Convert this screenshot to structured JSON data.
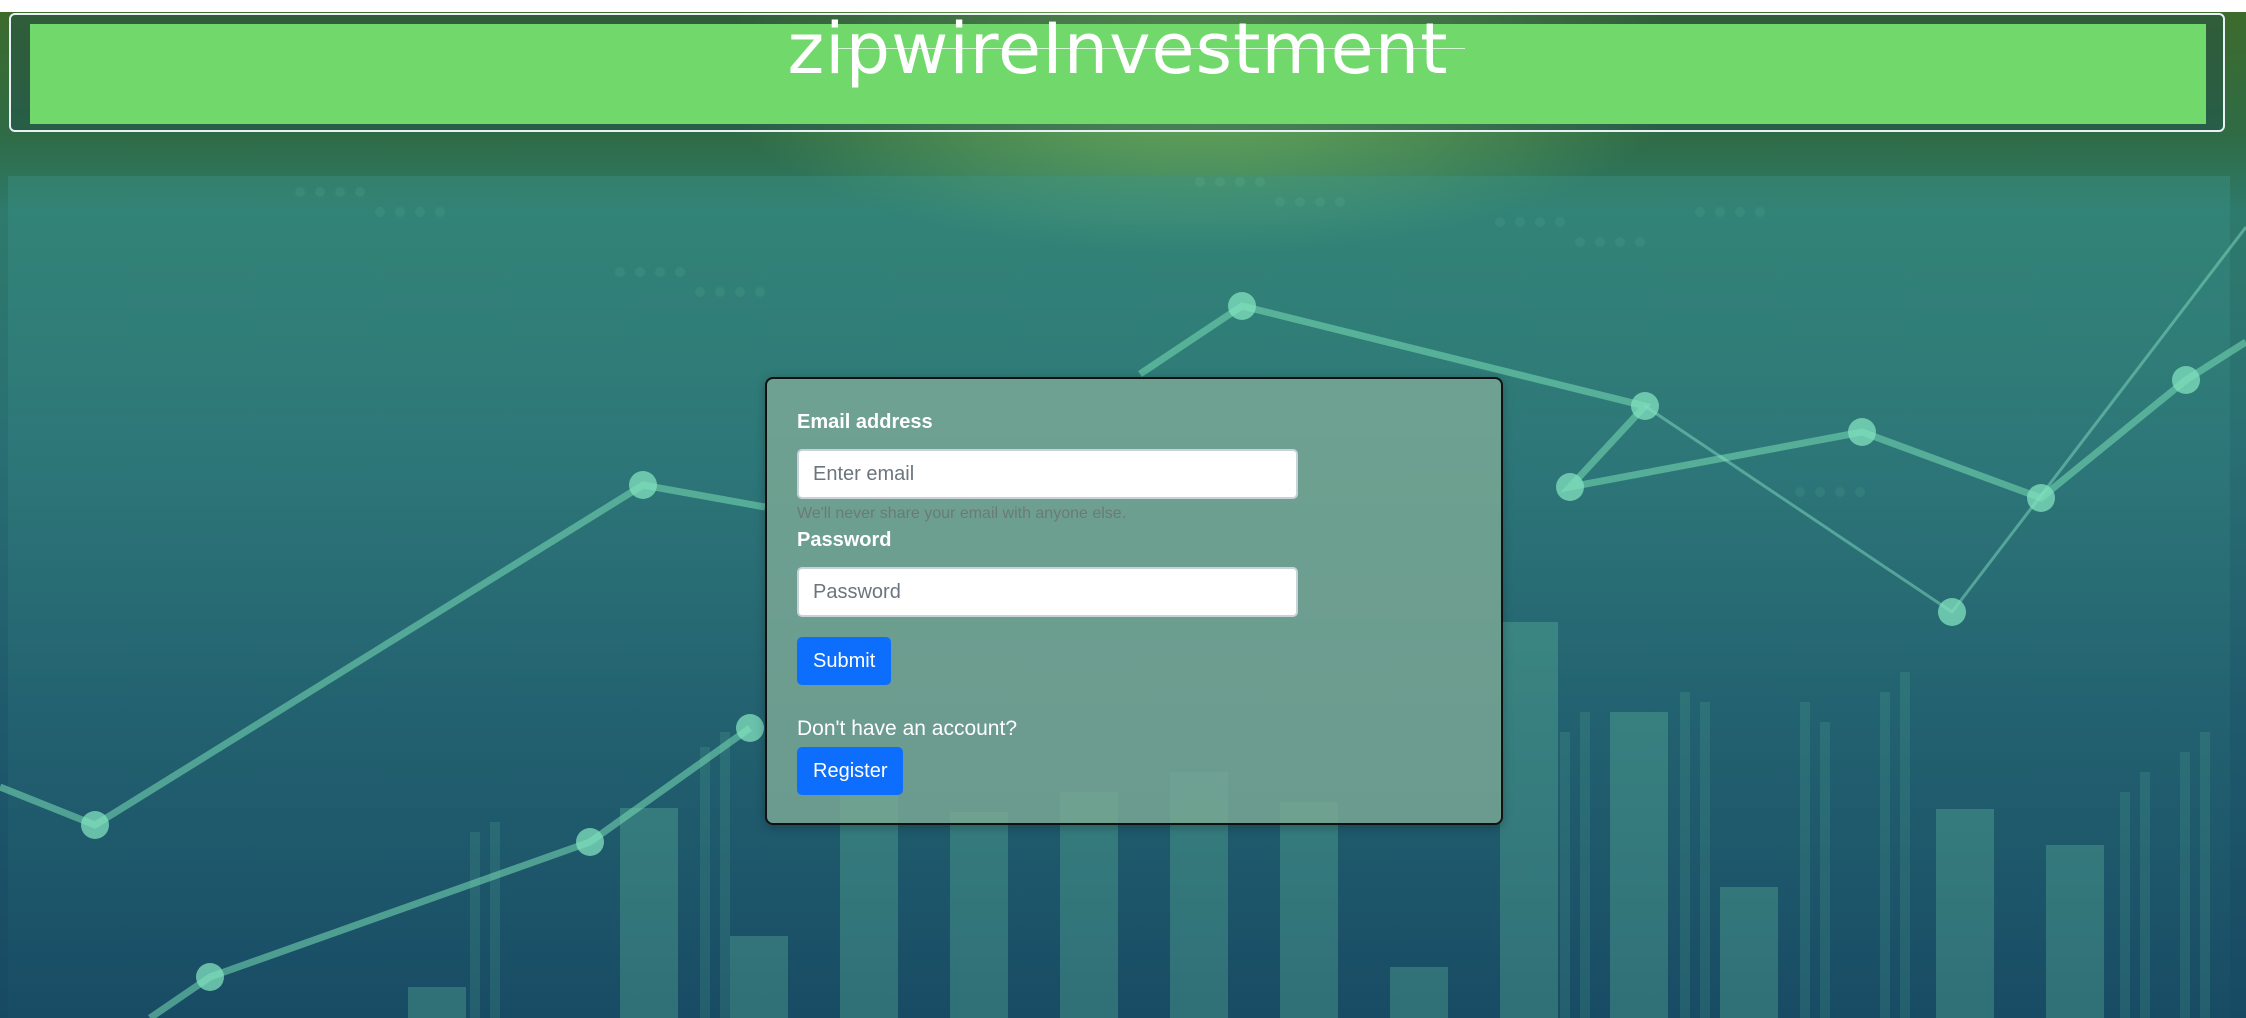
{
  "header": {
    "title": "zipwireInvestment"
  },
  "login_form": {
    "email_label": "Email address",
    "email_placeholder": "Enter email",
    "email_value": "",
    "email_help": "We'll never share your email with anyone else.",
    "password_label": "Password",
    "password_placeholder": "Password",
    "password_value": "",
    "submit_label": "Submit",
    "no_account_text": "Don't have an account?",
    "register_label": "Register"
  },
  "colors": {
    "header_green": "#71d96b",
    "button_blue": "#0d6efd",
    "card_bg": "#7daa96"
  }
}
